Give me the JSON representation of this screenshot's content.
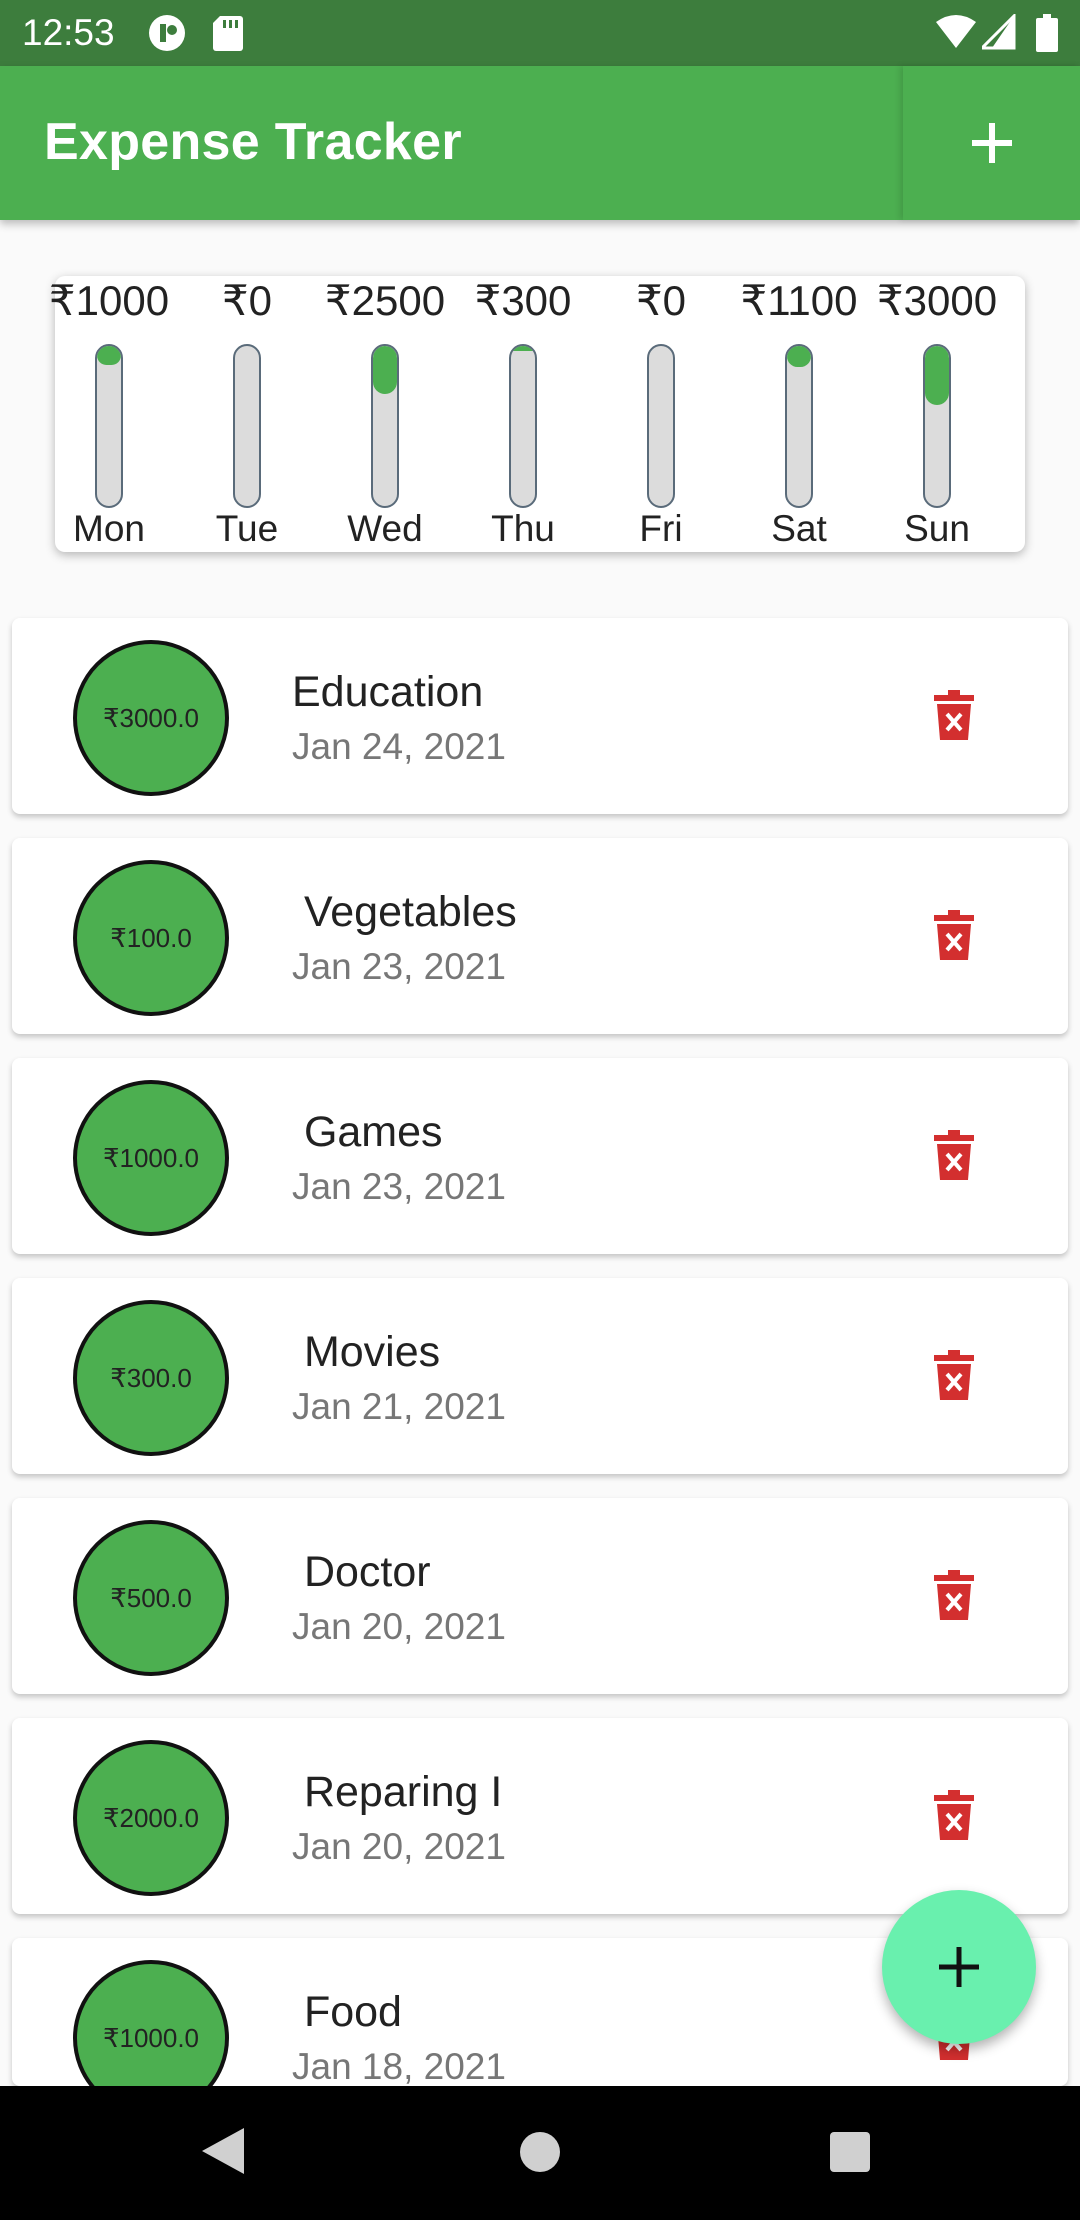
{
  "status_bar": {
    "time": "12:53"
  },
  "app_bar": {
    "title": "Expense Tracker",
    "add_icon": "plus-icon"
  },
  "chart_data": {
    "type": "bar",
    "categories": [
      "Mon",
      "Tue",
      "Wed",
      "Thu",
      "Fri",
      "Sat",
      "Sun"
    ],
    "labels": [
      "₹1000",
      "₹0",
      "₹2500",
      "₹300",
      "₹0",
      "₹1100",
      "₹3000"
    ],
    "values": [
      1000,
      0,
      2500,
      300,
      0,
      1100,
      3000
    ],
    "fill_fraction": [
      0.12,
      0,
      0.3,
      0.03,
      0,
      0.13,
      0.37
    ],
    "title": "",
    "xlabel": "",
    "ylabel": ""
  },
  "transactions": [
    {
      "amount": "₹3000.0",
      "title": "Education",
      "date": "Jan 24, 2021"
    },
    {
      "amount": "₹100.0",
      "title": " Vegetables",
      "date": "Jan 23, 2021"
    },
    {
      "amount": "₹1000.0",
      "title": " Games",
      "date": "Jan 23, 2021"
    },
    {
      "amount": "₹300.0",
      "title": " Movies",
      "date": "Jan 21, 2021"
    },
    {
      "amount": "₹500.0",
      "title": " Doctor",
      "date": "Jan 20, 2021"
    },
    {
      "amount": "₹2000.0",
      "title": " Reparing I",
      "date": "Jan 20, 2021"
    },
    {
      "amount": "₹1000.0",
      "title": " Food",
      "date": "Jan 18, 2021"
    }
  ],
  "colors": {
    "primary": "#4caf50",
    "primary_dark": "#3d7d3d",
    "accent": "#69f0ae",
    "delete": "#d32f2f"
  },
  "fab": {
    "icon": "plus-icon"
  }
}
